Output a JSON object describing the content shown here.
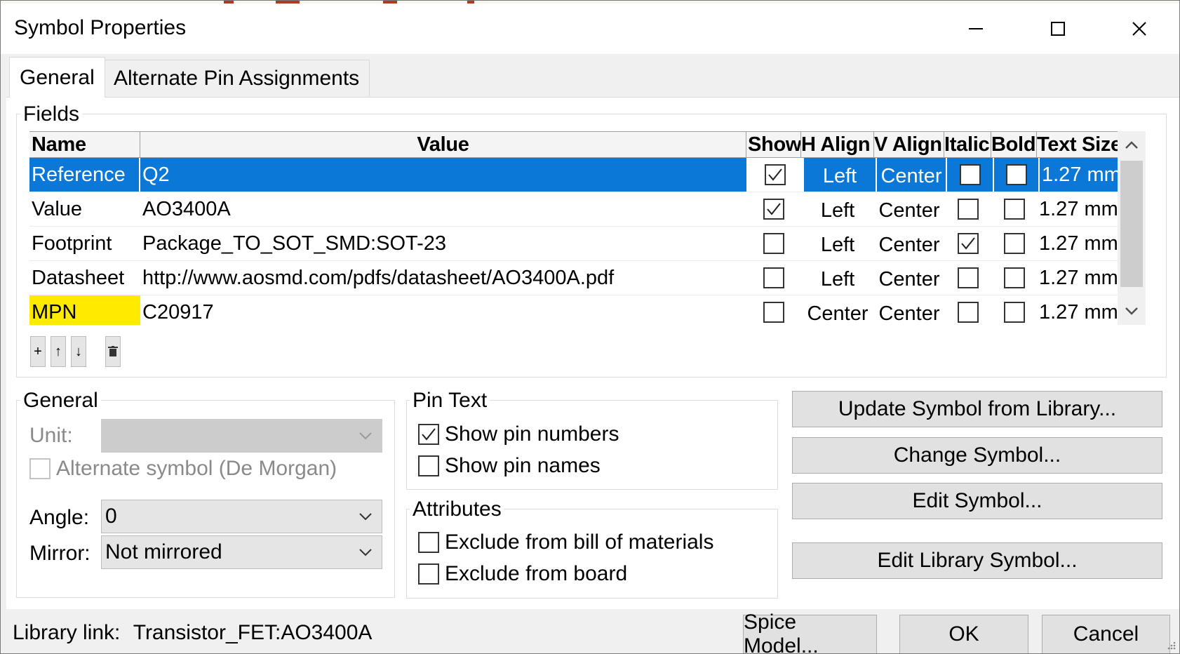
{
  "window": {
    "title": "Symbol Properties",
    "minimize_label": "─",
    "maximize_label": "☐",
    "close_label": "✕"
  },
  "tabs": [
    {
      "label": "General",
      "active": true
    },
    {
      "label": "Alternate Pin Assignments",
      "active": false
    }
  ],
  "fields": {
    "group_label": "Fields",
    "columns": [
      "Name",
      "Value",
      "Show",
      "H Align",
      "V Align",
      "Italic",
      "Bold",
      "Text Size"
    ],
    "rows": [
      {
        "name": "Reference",
        "value": "Q2",
        "show": true,
        "h_align": "Left",
        "v_align": "Center",
        "italic": false,
        "bold": false,
        "text_size": "1.27 mm",
        "selected": true
      },
      {
        "name": "Value",
        "value": "AO3400A",
        "show": true,
        "h_align": "Left",
        "v_align": "Center",
        "italic": false,
        "bold": false,
        "text_size": "1.27 mm"
      },
      {
        "name": "Footprint",
        "value": "Package_TO_SOT_SMD:SOT-23",
        "show": false,
        "h_align": "Left",
        "v_align": "Center",
        "italic": true,
        "bold": false,
        "text_size": "1.27 mm"
      },
      {
        "name": "Datasheet",
        "value": "http://www.aosmd.com/pdfs/datasheet/AO3400A.pdf",
        "show": false,
        "h_align": "Left",
        "v_align": "Center",
        "italic": false,
        "bold": false,
        "text_size": "1.27 mm"
      },
      {
        "name": "MPN",
        "value": "C20917",
        "show": false,
        "h_align": "Center",
        "v_align": "Center",
        "italic": false,
        "bold": false,
        "text_size": "1.27 mm",
        "highlight": "#ffea00"
      }
    ],
    "buttons": {
      "add": "+",
      "up": "↑",
      "down": "↓",
      "delete": "🗑"
    }
  },
  "general": {
    "group_label": "General",
    "unit_label": "Unit:",
    "unit_value": "",
    "alt_symbol_label": "Alternate symbol (De Morgan)",
    "alt_symbol_checked": false,
    "angle_label": "Angle:",
    "angle_value": "0",
    "mirror_label": "Mirror:",
    "mirror_value": "Not mirrored"
  },
  "pin_text": {
    "group_label": "Pin Text",
    "show_pin_numbers_label": "Show pin numbers",
    "show_pin_numbers": true,
    "show_pin_names_label": "Show pin names",
    "show_pin_names": false
  },
  "attributes": {
    "group_label": "Attributes",
    "exclude_bom_label": "Exclude from bill of materials",
    "exclude_bom": false,
    "exclude_board_label": "Exclude from board",
    "exclude_board": false
  },
  "actions": {
    "update_symbol": "Update Symbol from Library...",
    "change_symbol": "Change Symbol...",
    "edit_symbol": "Edit Symbol...",
    "edit_library_symbol": "Edit Library Symbol..."
  },
  "footer": {
    "library_link_label": "Library link:",
    "library_link_value": "Transistor_FET:AO3400A",
    "spice_model": "Spice Model...",
    "ok": "OK",
    "cancel": "Cancel"
  },
  "colors": {
    "selection": "#0b78d7",
    "highlight": "#ffea00",
    "button_face": "#e1e1e1"
  }
}
